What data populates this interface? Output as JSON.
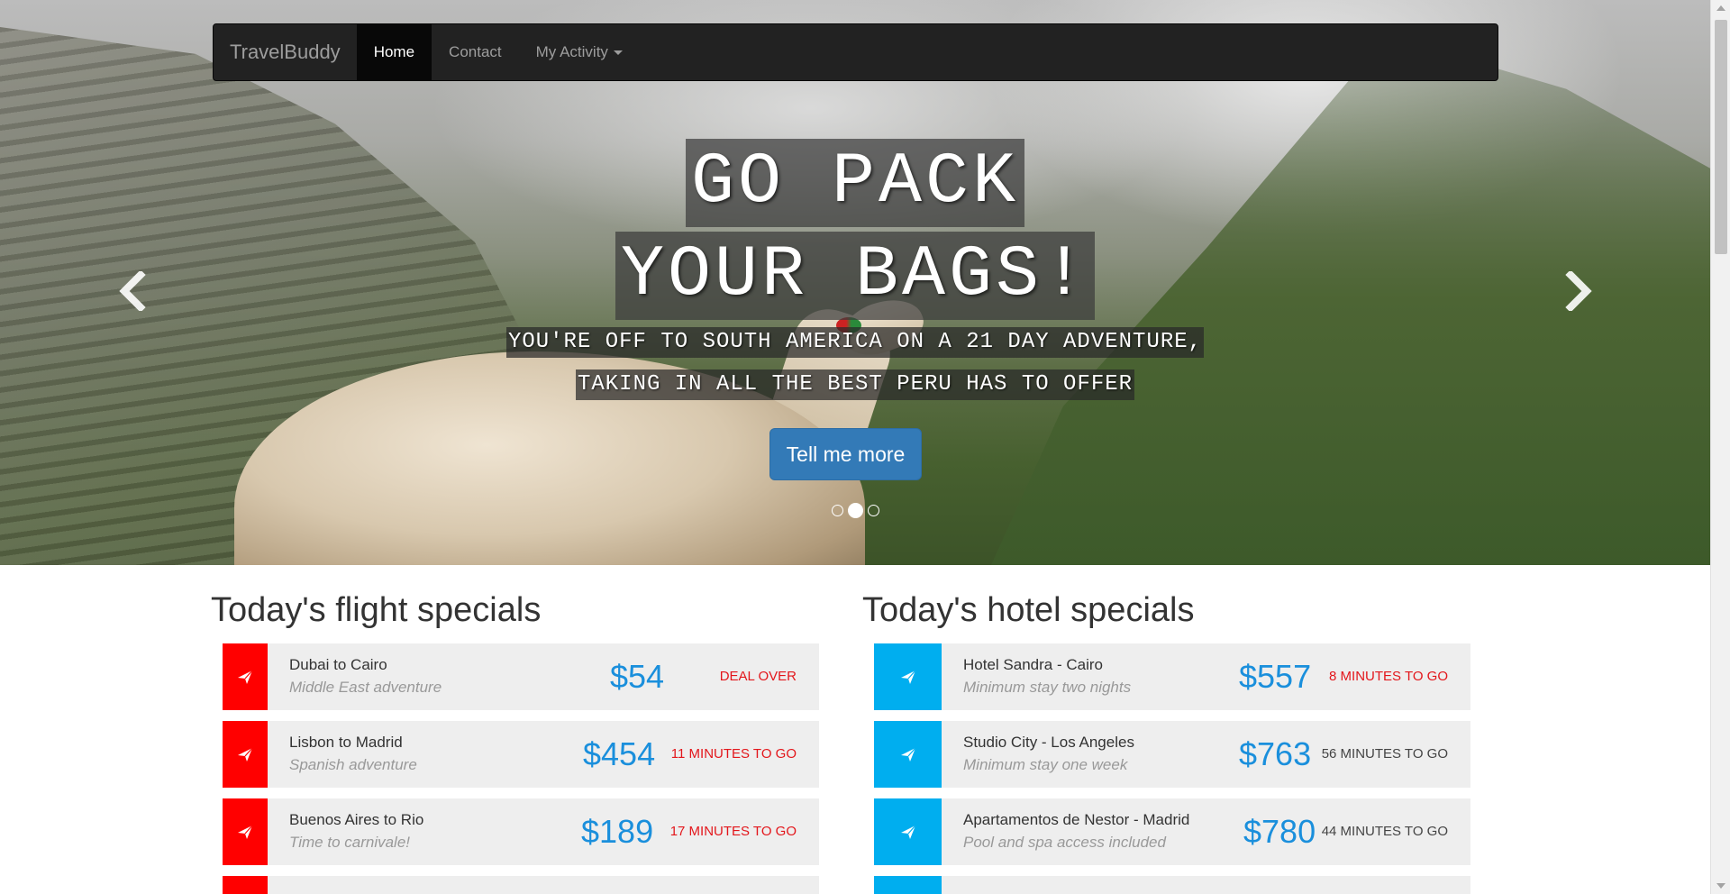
{
  "navbar": {
    "brand": "TravelBuddy",
    "items": [
      {
        "label": "Home",
        "active": true
      },
      {
        "label": "Contact",
        "active": false
      },
      {
        "label": "My Activity",
        "active": false,
        "dropdown": true
      }
    ]
  },
  "hero": {
    "headline_line1": "GO PACK",
    "headline_line2": "YOUR BAGS!",
    "sub_line1": "YOU'RE OFF TO SOUTH AMERICA ON A 21 DAY ADVENTURE,",
    "sub_line2": "TAKING IN ALL THE BEST PERU HAS TO OFFER",
    "cta_label": "Tell me more",
    "indicators": {
      "count": 3,
      "active_index": 1
    }
  },
  "flights": {
    "heading": "Today's flight specials",
    "deals": [
      {
        "title": "Dubai to Cairo",
        "subtitle": "Middle East adventure",
        "price": "$54",
        "status": "DEAL OVER",
        "status_color": "red"
      },
      {
        "title": "Lisbon to Madrid",
        "subtitle": "Spanish adventure",
        "price": "$454",
        "status": "11 MINUTES TO GO",
        "status_color": "red"
      },
      {
        "title": "Buenos Aires to Rio",
        "subtitle": "Time to carnivale!",
        "price": "$189",
        "status": "17 MINUTES TO GO",
        "status_color": "red"
      }
    ]
  },
  "hotels": {
    "heading": "Today's hotel specials",
    "deals": [
      {
        "title": "Hotel Sandra - Cairo",
        "subtitle": "Minimum stay two nights",
        "price": "$557",
        "status": "8 MINUTES TO GO",
        "status_color": "red"
      },
      {
        "title": "Studio City - Los Angeles",
        "subtitle": "Minimum stay one week",
        "price": "$763",
        "status": "56 MINUTES TO GO",
        "status_color": "dark"
      },
      {
        "title": "Apartamentos de Nestor - Madrid",
        "subtitle": "Pool and spa access included",
        "price": "$780",
        "status": "44 MINUTES TO GO",
        "status_color": "dark"
      }
    ]
  },
  "colors": {
    "flight_accent": "#ff0000",
    "hotel_accent": "#00aeef",
    "price": "#1a8fdc",
    "cta": "#337ab7",
    "navbar": "#222222"
  },
  "icons": {
    "deal_icon": "paper-plane-icon",
    "carousel_prev": "chevron-left-icon",
    "carousel_next": "chevron-right-icon"
  }
}
